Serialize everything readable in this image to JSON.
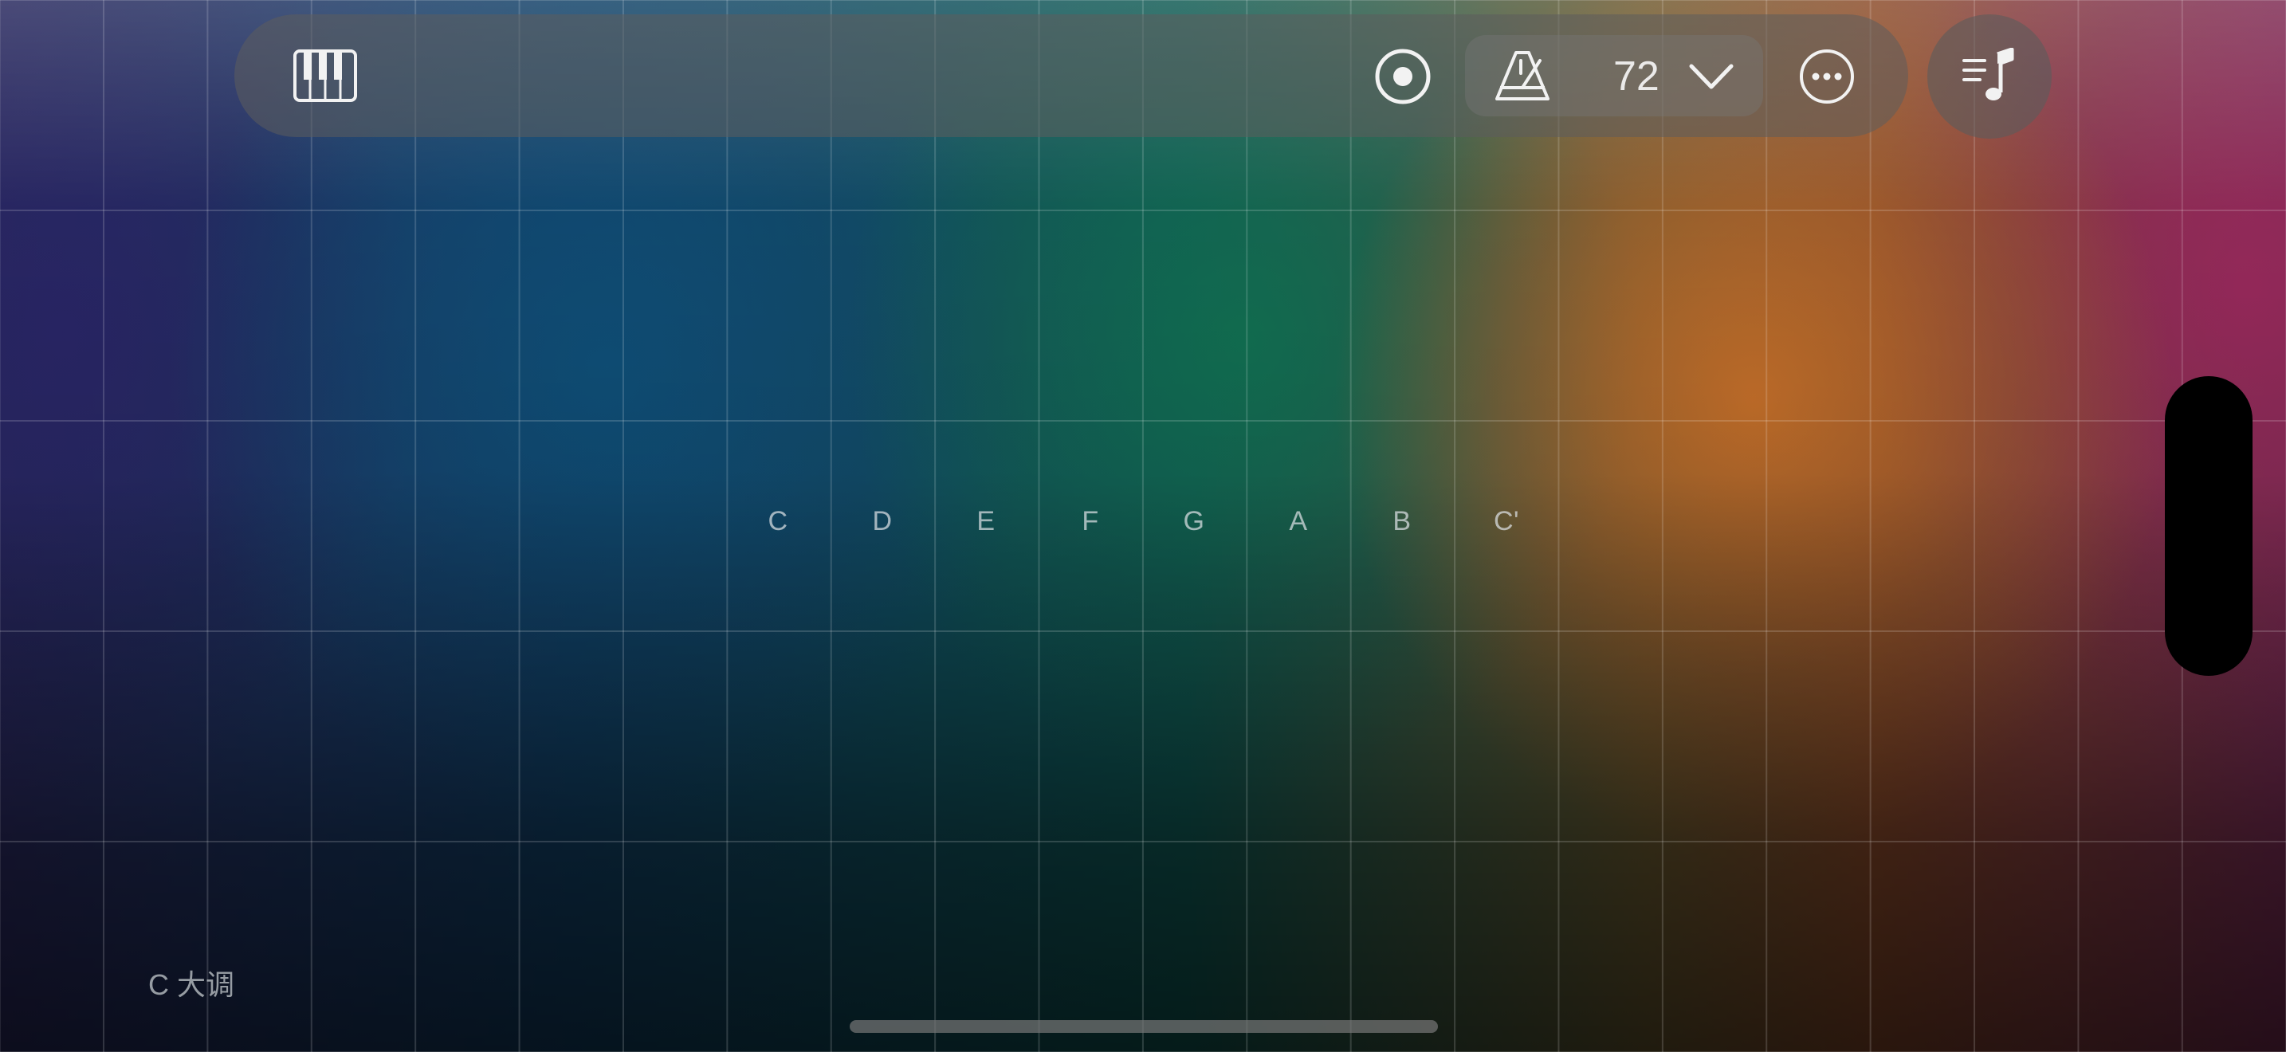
{
  "toolbar": {
    "piano_icon": "piano-keys-icon",
    "record_icon": "record-icon",
    "metronome_icon": "metronome-icon",
    "tempo": "72",
    "dropdown_icon": "chevron-down-icon",
    "more_icon": "ellipsis-circle-icon"
  },
  "score_button": {
    "icon": "music-note-list-icon"
  },
  "notes": [
    "C",
    "D",
    "E",
    "F",
    "G",
    "A",
    "B",
    "C'"
  ],
  "key_label": "C 大调",
  "colors": {
    "toolbar_bg": "#5c5c5c",
    "icon_color": "#f2f2f2"
  }
}
